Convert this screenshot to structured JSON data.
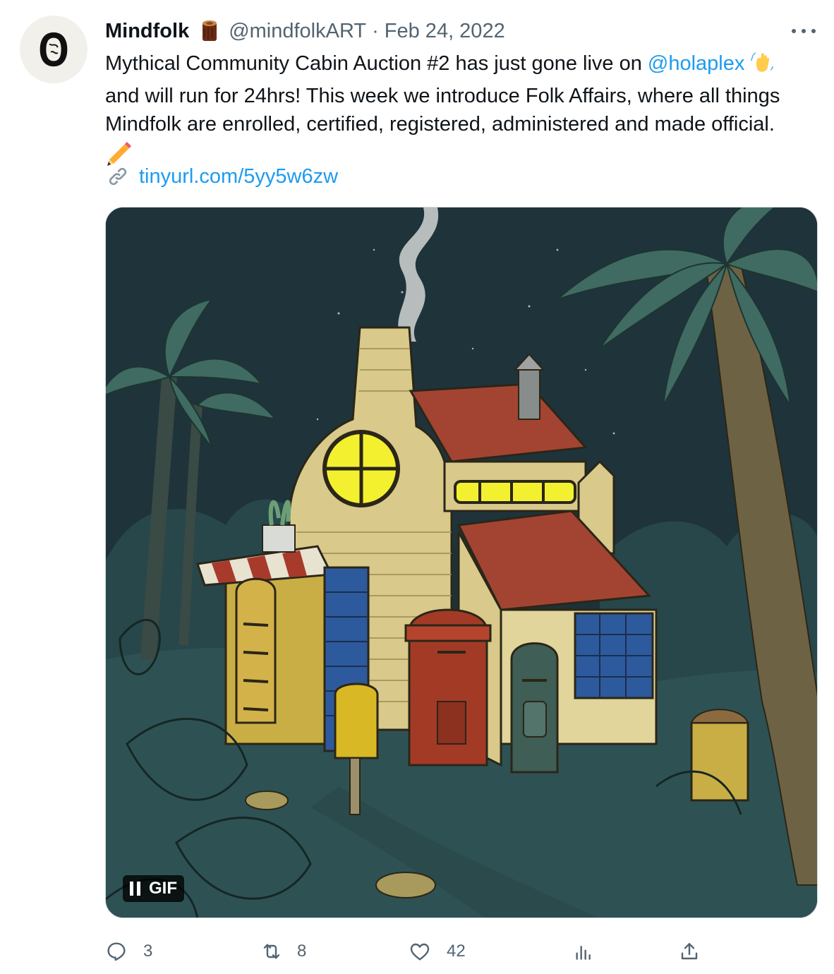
{
  "tweet": {
    "author": {
      "name": "Mindfolk",
      "handle": "@mindfolkART",
      "separator": "·",
      "date": "Feb 24, 2022"
    },
    "text": {
      "line1_before_mention": "Mythical Community Cabin Auction #2 has just gone live on ",
      "mention": "@holaplex",
      "line2": "and will run for 24hrs! This week we introduce Folk Affairs, where all things",
      "line3": "Mindfolk are enrolled, certified, registered, administered and made official."
    },
    "link": {
      "url": "tinyurl.com/5yy5w6zw"
    },
    "media": {
      "badge_label": "GIF"
    },
    "actions": {
      "reply_count": "3",
      "retweet_count": "8",
      "like_count": "42"
    },
    "colors": {
      "accent": "#1d9bf0",
      "secondary_text": "#536471",
      "primary_text": "#0f1419"
    },
    "icons": {
      "avatar": "mindfolk-logo-icon",
      "name_emoji": "wood-log-icon",
      "mention_emoji": "waving-hand-icon",
      "text_emoji": "pencil-icon",
      "link": "link-chain-icon",
      "more": "more-dots-icon",
      "reply": "reply-icon",
      "retweet": "retweet-icon",
      "like": "heart-icon",
      "analytics": "analytics-icon",
      "share": "share-icon"
    }
  }
}
